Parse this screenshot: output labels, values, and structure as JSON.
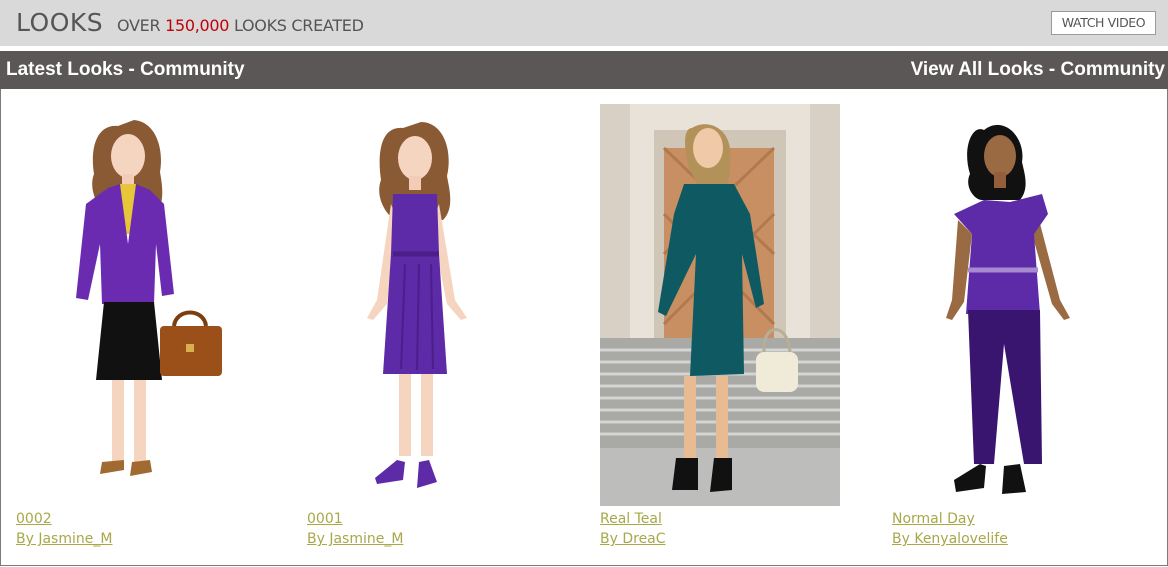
{
  "header": {
    "title": "LOOKS",
    "subtitle_prefix": "OVER",
    "subtitle_count": "150,000",
    "subtitle_suffix": "LOOKS CREATED",
    "watch_video_label": "WATCH VIDEO"
  },
  "section": {
    "title": "Latest Looks - Community",
    "view_all_label": "View All Looks - Community"
  },
  "looks": [
    {
      "name": "0002",
      "author": "By Jasmine_M"
    },
    {
      "name": "0001",
      "author": "By Jasmine_M"
    },
    {
      "name": "Real Teal",
      "author": "By DreaC"
    },
    {
      "name": "Normal Day",
      "author": "By Kenyalovelife"
    }
  ],
  "colors": {
    "top_bar": "#d9d9d9",
    "header_bar": "#5b5757",
    "count_red": "#c0000a",
    "link_olive": "#a8a848",
    "purple": "#6a2bb0",
    "teal": "#0f5a62"
  }
}
